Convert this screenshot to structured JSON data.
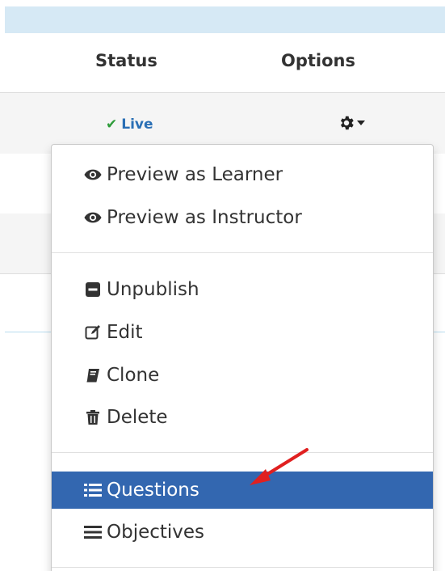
{
  "table": {
    "headers": {
      "status": "Status",
      "options": "Options"
    },
    "row1": {
      "status": "Live"
    }
  },
  "options_menu": {
    "items": [
      {
        "label": "Preview as Learner",
        "icon": "eye-icon"
      },
      {
        "label": "Preview as Instructor",
        "icon": "eye-icon"
      },
      {
        "label": "Unpublish",
        "icon": "minus-square-icon"
      },
      {
        "label": "Edit",
        "icon": "edit-icon"
      },
      {
        "label": "Clone",
        "icon": "book-icon"
      },
      {
        "label": "Delete",
        "icon": "trash-icon"
      },
      {
        "label": "Questions",
        "icon": "list-icon"
      },
      {
        "label": "Objectives",
        "icon": "bars-icon"
      }
    ],
    "active_item": "Questions"
  },
  "colors": {
    "live_text": "#2a6fb5",
    "live_check": "#2e9c3a",
    "active_bg": "#3367b0",
    "annotation_arrow": "#e02020",
    "top_bar": "#d6e9f5"
  }
}
